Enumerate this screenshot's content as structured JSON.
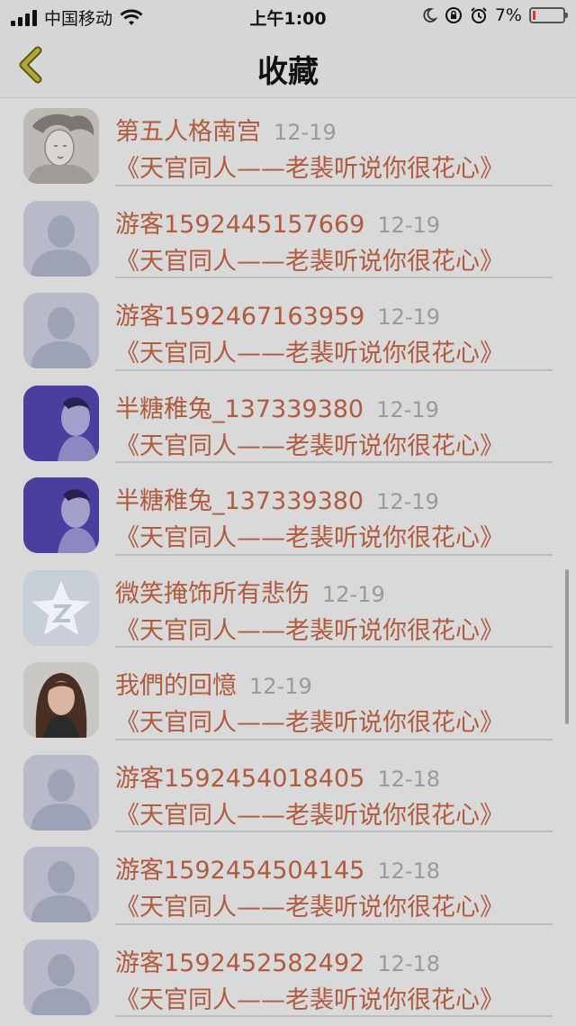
{
  "status_bar": {
    "carrier": "中国移动",
    "time": "上午1:00",
    "battery": "7%"
  },
  "nav": {
    "title": "收藏"
  },
  "items": [
    {
      "name": "第五人格南宫",
      "date": "12-19",
      "subtitle": "《天官同人——老裴听说你很花心》",
      "avatar": "sketch-portrait"
    },
    {
      "name": "游客1592445157669",
      "date": "12-19",
      "subtitle": "《天官同人——老裴听说你很花心》",
      "avatar": "default-person"
    },
    {
      "name": "游客1592467163959",
      "date": "12-19",
      "subtitle": "《天官同人——老裴听说你很花心》",
      "avatar": "default-person"
    },
    {
      "name": "半糖稚兔_137339380",
      "date": "12-19",
      "subtitle": "《天官同人——老裴听说你很花心》",
      "avatar": "purple-photo"
    },
    {
      "name": "半糖稚兔_137339380",
      "date": "12-19",
      "subtitle": "《天官同人——老裴听说你很花心》",
      "avatar": "purple-photo"
    },
    {
      "name": "微笑掩饰所有悲伤",
      "date": "12-19",
      "subtitle": "《天官同人——老裴听说你很花心》",
      "avatar": "qzone-star"
    },
    {
      "name": "我們的回憶",
      "date": "12-19",
      "subtitle": "《天官同人——老裴听说你很花心》",
      "avatar": "woman-photo"
    },
    {
      "name": "游客1592454018405",
      "date": "12-18",
      "subtitle": "《天官同人——老裴听说你很花心》",
      "avatar": "default-person"
    },
    {
      "name": "游客1592454504145",
      "date": "12-18",
      "subtitle": "《天官同人——老裴听说你很花心》",
      "avatar": "default-person"
    },
    {
      "name": "游客1592452582492",
      "date": "12-18",
      "subtitle": "《天官同人——老裴听说你很花心》",
      "avatar": "default-person"
    }
  ],
  "colors": {
    "accent": "#b05a3e",
    "date": "#9a9a9a",
    "overlay": "#d9d9d9"
  }
}
